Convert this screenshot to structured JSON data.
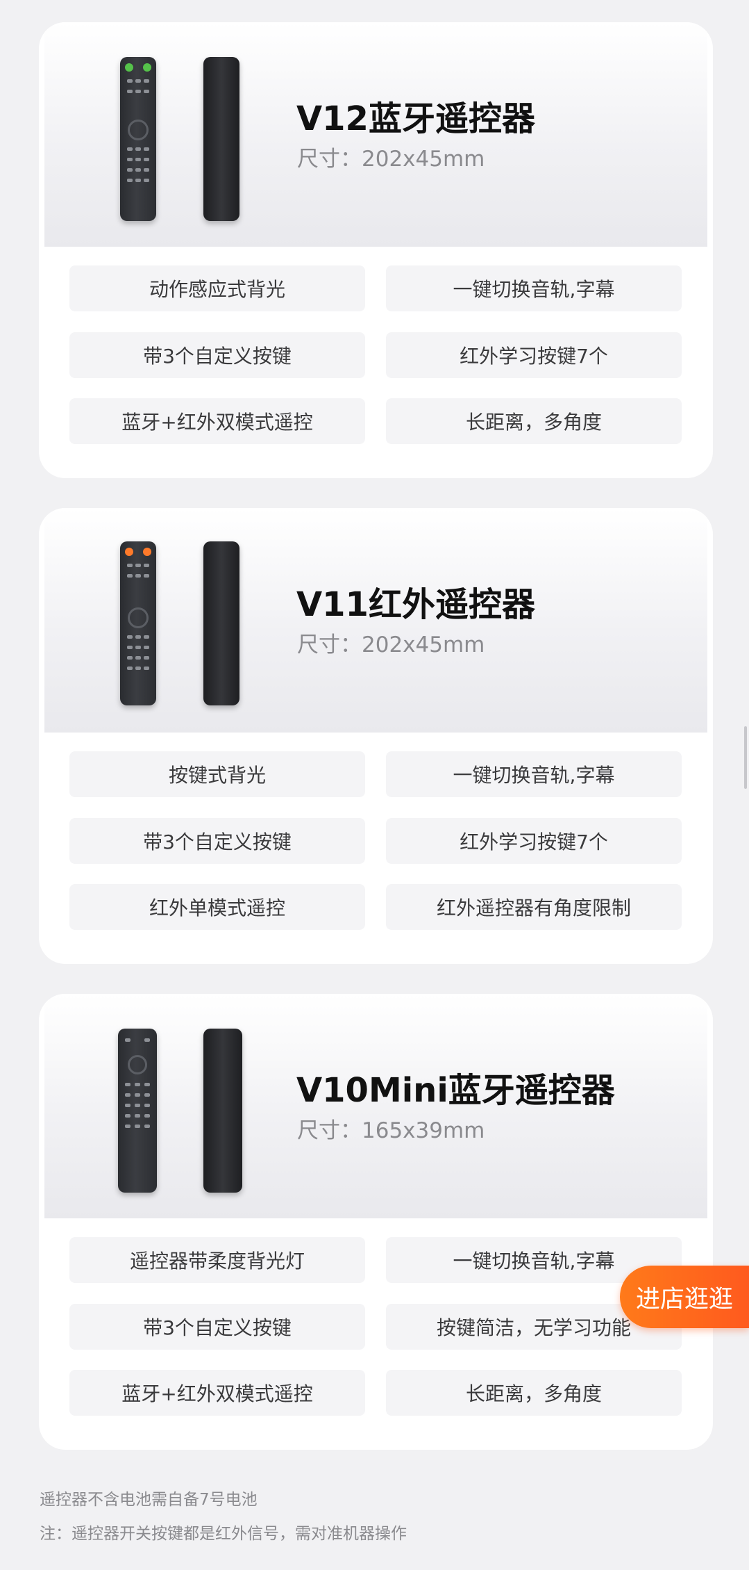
{
  "products": [
    {
      "title": "V12蓝牙遥控器",
      "size": "尺寸：202x45mm",
      "features": [
        "动作感应式背光",
        "一键切换音轨,字幕",
        "带3个自定义按键",
        "红外学习按键7个",
        "蓝牙+红外双模式遥控",
        "长距离，多角度"
      ]
    },
    {
      "title": "V11红外遥控器",
      "size": "尺寸：202x45mm",
      "features": [
        "按键式背光",
        "一键切换音轨,字幕",
        "带3个自定义按键",
        "红外学习按键7个",
        "红外单模式遥控",
        "红外遥控器有角度限制"
      ]
    },
    {
      "title": "V10Mini蓝牙遥控器",
      "size": "尺寸：165x39mm",
      "features": [
        "遥控器带柔度背光灯",
        "一键切换音轨,字幕",
        "带3个自定义按键",
        "按键简洁，无学习功能",
        "蓝牙+红外双模式遥控",
        "长距离，多角度"
      ]
    }
  ],
  "notes": {
    "battery": "遥控器不含电池需自备7号电池",
    "power": "注：遥控器开关按键都是红外信号，需对准机器操作"
  },
  "store_button": "进店逛逛",
  "colors": {
    "accent": "#ff6a1e",
    "top_buttons_v12": "#55c24a",
    "top_buttons_v11": "#ff7a2a"
  }
}
